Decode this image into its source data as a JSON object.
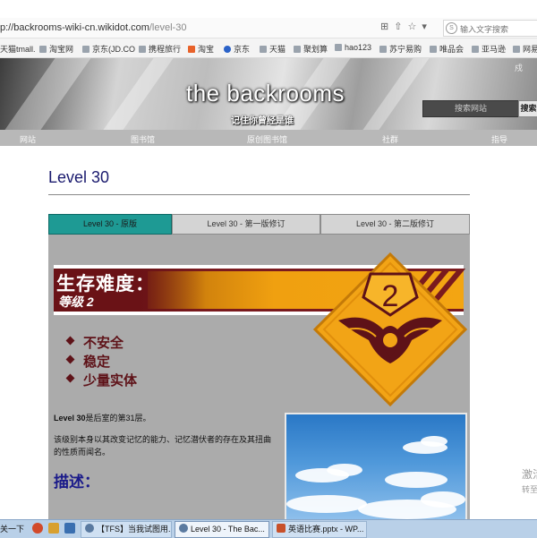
{
  "browser": {
    "url_host": "p://backrooms-wiki-cn.wikidot.com",
    "url_path": "/level-30",
    "search_placeholder": "输入文字搜索",
    "bookmarks": [
      "天猫tmall.",
      "淘宝网",
      "京东(JD.CO",
      "携程旅行",
      "淘宝",
      "京东",
      "天猫",
      "聚划算",
      "hao123",
      "苏宁易购",
      "唯品会",
      "亚马逊",
      "网易"
    ]
  },
  "site": {
    "title": "the backrooms",
    "subtitle": "记住你曾经是谁",
    "search_placeholder": "搜索网站",
    "search_button": "搜索",
    "corner_char": "戍",
    "nav": [
      "网站",
      "图书馆",
      "原创图书馆",
      "社群",
      "指导"
    ]
  },
  "page": {
    "title": "Level 30",
    "tabs": [
      {
        "label": "Level 30 - 原版",
        "active": true
      },
      {
        "label": "Level 30 - 第一版修订",
        "active": false
      },
      {
        "label": "Level 30 - 第二版修订",
        "active": false
      }
    ],
    "survival": {
      "title": "生存难度：",
      "level": "等级 2",
      "badge_number": "2"
    },
    "bullets": [
      "不安全",
      "稳定",
      "少量实体"
    ],
    "intro_bold": "Level 30",
    "intro_rest": "是后室的第31层。",
    "paragraph": "该级别本身以其改变记忆的能力、记忆潜伏者的存在及其扭曲的性质而闻名。",
    "section_heading": "描述："
  },
  "watermark": {
    "line1": "激活",
    "line2": "转至"
  },
  "taskbar": {
    "start_label": "关一下",
    "items": [
      {
        "label": "【TFS】当我试图用...",
        "active": false
      },
      {
        "label": "Level 30 - The Bac...",
        "active": true
      },
      {
        "label": "英语比赛.pptx - WP...",
        "active": false
      }
    ]
  },
  "colors": {
    "accent_tab": "#1e9a94",
    "title_blue": "#1a1a6e",
    "banner_maroon": "#7a1a1e",
    "banner_orange": "#f0a010",
    "bullet_maroon": "#5e1218"
  }
}
